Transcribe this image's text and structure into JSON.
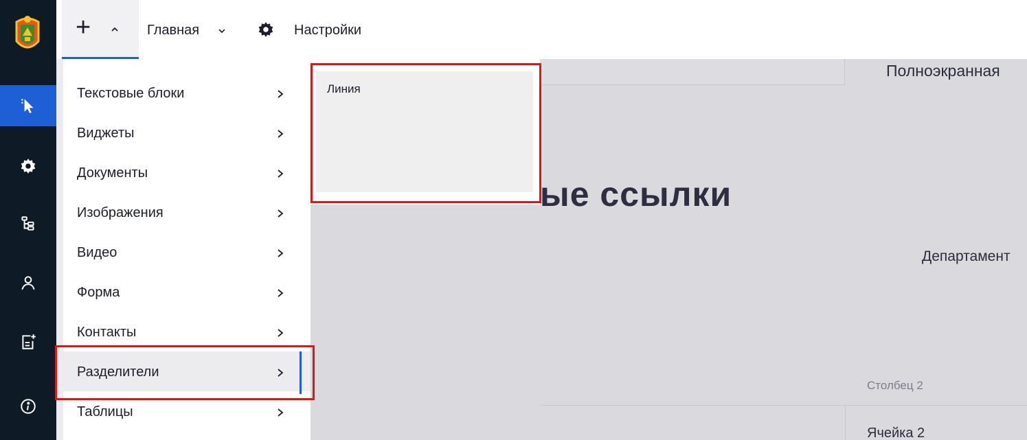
{
  "sidebar": {
    "items": [
      {
        "icon": "pointer-icon",
        "active": true
      },
      {
        "icon": "gear-icon",
        "active": false
      },
      {
        "icon": "tree-icon",
        "active": false
      },
      {
        "icon": "user-icon",
        "active": false
      },
      {
        "icon": "add-page-icon",
        "active": false
      },
      {
        "icon": "info-icon",
        "active": false
      }
    ],
    "logo": "coat-of-arms-icon"
  },
  "toolbar": {
    "add_label": "+",
    "home_label": "Главная",
    "settings_label": "Настройки"
  },
  "menu": {
    "items": [
      {
        "label": "Текстовые блоки"
      },
      {
        "label": "Виджеты"
      },
      {
        "label": "Документы"
      },
      {
        "label": "Изображения"
      },
      {
        "label": "Видео"
      },
      {
        "label": "Форма"
      },
      {
        "label": "Контакты"
      },
      {
        "label": "Разделители",
        "highlighted": true
      },
      {
        "label": "Таблицы"
      }
    ],
    "submenu": {
      "items": [
        {
          "label": "Линия"
        }
      ]
    }
  },
  "background": {
    "fullscreen_label": "Полноэкранная",
    "heading_fragment": "ые ссылки",
    "department_label": "Департамент",
    "column_label": "Столбец 2",
    "cell_label": "Ячейка 2"
  },
  "colors": {
    "sidebar": "#0e1a26",
    "accent": "#1f5fd6",
    "annotation": "#e01616"
  }
}
